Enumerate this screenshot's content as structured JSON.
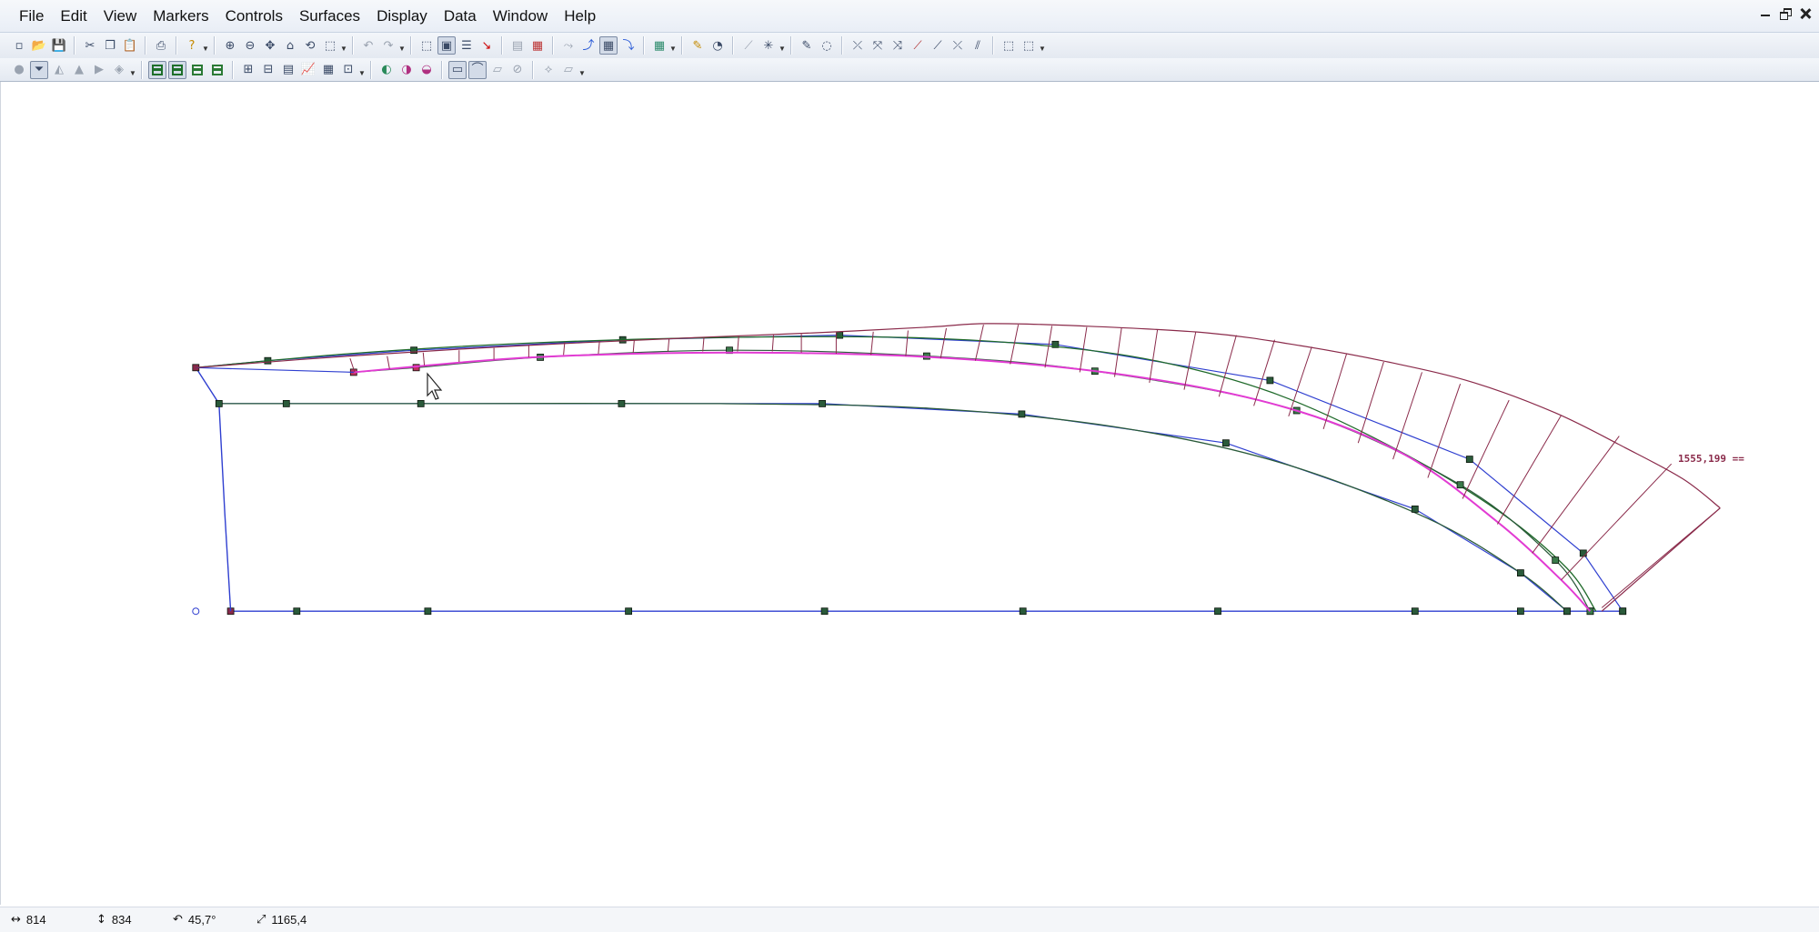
{
  "menubar": {
    "items": [
      "File",
      "Edit",
      "View",
      "Markers",
      "Controls",
      "Surfaces",
      "Display",
      "Data",
      "Window",
      "Help"
    ]
  },
  "toolbar1": {
    "buttons": [
      {
        "icon": "new-file-icon",
        "glyph": "▫"
      },
      {
        "icon": "open-folder-icon",
        "glyph": "📂"
      },
      {
        "icon": "save-icon",
        "glyph": "💾"
      },
      {
        "sep": true
      },
      {
        "icon": "cut-icon",
        "glyph": "✂"
      },
      {
        "icon": "copy-icon",
        "glyph": "❐"
      },
      {
        "icon": "paste-icon",
        "glyph": "📋"
      },
      {
        "sep": true
      },
      {
        "icon": "print-icon",
        "glyph": "⎙"
      },
      {
        "sep": true
      },
      {
        "icon": "help-icon",
        "glyph": "?",
        "color": "#c58a00",
        "drop": true
      },
      {
        "sep": true
      },
      {
        "icon": "zoom-in-icon",
        "glyph": "⊕"
      },
      {
        "icon": "zoom-out-icon",
        "glyph": "⊖"
      },
      {
        "icon": "pan-icon",
        "glyph": "✥"
      },
      {
        "icon": "home-view-icon",
        "glyph": "⌂"
      },
      {
        "icon": "rotate-view-icon",
        "glyph": "⟲"
      },
      {
        "icon": "select-tool-icon",
        "glyph": "⬚",
        "drop": true
      },
      {
        "sep": true
      },
      {
        "icon": "undo-icon",
        "glyph": "↶",
        "dim": true
      },
      {
        "icon": "redo-icon",
        "glyph": "↷",
        "dim": true,
        "drop": true
      },
      {
        "sep": true
      },
      {
        "icon": "marquee-select-icon",
        "glyph": "⬚"
      },
      {
        "icon": "frame-view-icon",
        "glyph": "▣",
        "pressed": true
      },
      {
        "icon": "list-view-icon",
        "glyph": "☰"
      },
      {
        "icon": "pick-icon",
        "glyph": "↘",
        "color": "#c00"
      },
      {
        "sep": true
      },
      {
        "icon": "layers-icon",
        "glyph": "▤",
        "dim": true
      },
      {
        "icon": "sheets-icon",
        "glyph": "▦",
        "color": "#b33"
      },
      {
        "sep": true
      },
      {
        "icon": "curve-a-icon",
        "glyph": "⤳",
        "dim": true
      },
      {
        "icon": "curve-b-icon",
        "glyph": "⤴",
        "color": "#2a5bd7"
      },
      {
        "icon": "grid-toggle-icon",
        "glyph": "▦",
        "pressed": true
      },
      {
        "icon": "curve-c-icon",
        "glyph": "⤵",
        "color": "#2a5bd7"
      },
      {
        "sep": true
      },
      {
        "icon": "mesh-icon",
        "glyph": "▦",
        "color": "#2a8a6a",
        "drop": true
      },
      {
        "sep": true
      },
      {
        "icon": "pencil-icon",
        "glyph": "✎",
        "color": "#c48a00"
      },
      {
        "icon": "measure-icon",
        "glyph": "◔"
      },
      {
        "sep": true
      },
      {
        "icon": "line-tool-icon",
        "glyph": "⟋",
        "dim": true
      },
      {
        "icon": "node-tool-icon",
        "glyph": "✳",
        "drop": true
      },
      {
        "sep": true
      },
      {
        "icon": "draw-icon",
        "glyph": "✎"
      },
      {
        "icon": "arc-icon",
        "glyph": "◌"
      },
      {
        "sep": true
      },
      {
        "icon": "trim-a-icon",
        "glyph": "⤫"
      },
      {
        "icon": "trim-b-icon",
        "glyph": "⤧"
      },
      {
        "icon": "trim-c-icon",
        "glyph": "⤨"
      },
      {
        "icon": "extend-icon",
        "glyph": "⟋",
        "color": "#b03030"
      },
      {
        "icon": "split-icon",
        "glyph": "⟋"
      },
      {
        "icon": "cross-icon",
        "glyph": "⤫"
      },
      {
        "icon": "offset-icon",
        "glyph": "⫽"
      },
      {
        "sep": true
      },
      {
        "icon": "window-select-icon",
        "glyph": "⬚"
      },
      {
        "icon": "transform-icon",
        "glyph": "⬚",
        "drop": true
      }
    ]
  },
  "toolbar2": {
    "buttons": [
      {
        "icon": "sphere-icon",
        "glyph": "●",
        "dim": true
      },
      {
        "icon": "funnel-icon",
        "glyph": "⏷",
        "pressed": true
      },
      {
        "icon": "shape-a-icon",
        "glyph": "◭",
        "dim": true
      },
      {
        "icon": "cone-icon",
        "glyph": "▲",
        "dim": true
      },
      {
        "icon": "shape-b-icon",
        "glyph": "▶",
        "dim": true
      },
      {
        "icon": "shape-c-icon",
        "glyph": "◈",
        "dim": true,
        "drop": true
      },
      {
        "sep": true
      },
      {
        "icon": "view-plan-icon",
        "swatch": "#1e6f2a",
        "pressed": true
      },
      {
        "icon": "view-profile-icon",
        "swatch": "#1e6f2a",
        "pressed": true
      },
      {
        "icon": "view-body-icon",
        "swatch": "#2b7a35"
      },
      {
        "icon": "view-3d-icon",
        "swatch": "#2b7a35"
      },
      {
        "sep": true
      },
      {
        "icon": "table-a-icon",
        "glyph": "⊞"
      },
      {
        "icon": "table-b-icon",
        "glyph": "⊟"
      },
      {
        "icon": "table-c-icon",
        "glyph": "▤"
      },
      {
        "icon": "graph-icon",
        "glyph": "📈"
      },
      {
        "icon": "data-grid-icon",
        "glyph": "▦"
      },
      {
        "icon": "settings-table-icon",
        "glyph": "⊡",
        "drop": true
      },
      {
        "sep": true
      },
      {
        "icon": "surface-a-icon",
        "glyph": "◐",
        "color": "#2a8a5a"
      },
      {
        "icon": "surface-b-icon",
        "glyph": "◑",
        "color": "#b03080"
      },
      {
        "icon": "surface-c-icon",
        "glyph": "◒",
        "color": "#b03080"
      },
      {
        "sep": true
      },
      {
        "icon": "display-a-icon",
        "glyph": "▭",
        "pressed": true
      },
      {
        "icon": "display-b-icon",
        "glyph": "⌒",
        "pressed": true
      },
      {
        "icon": "display-c-icon",
        "glyph": "▱",
        "dim": true
      },
      {
        "icon": "display-d-icon",
        "glyph": "⊘",
        "dim": true
      },
      {
        "sep": true
      },
      {
        "icon": "render-a-icon",
        "glyph": "⟡",
        "dim": true
      },
      {
        "icon": "render-b-icon",
        "glyph": "▱",
        "dim": true,
        "drop": true
      }
    ]
  },
  "canvas": {
    "dimension_label": "1555,199 ==",
    "colors": {
      "blue": "#2f3fd0",
      "magenta": "#e23bd3",
      "maroon": "#8a2a4a",
      "green": "#1f6a2a",
      "darkgreen": "#2a5a3a",
      "node": "#1e2a1e"
    }
  },
  "status": {
    "x_value": "814",
    "y_value": "834",
    "angle_value": "45,7°",
    "length_value": "1165,4"
  }
}
